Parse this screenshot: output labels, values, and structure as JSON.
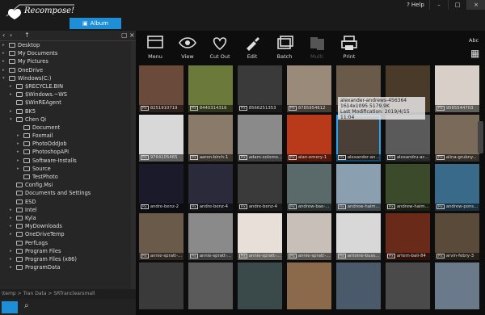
{
  "app": {
    "name": "Recompose!",
    "tab": "Album"
  },
  "window": {
    "help": "Help",
    "minimize": "–",
    "maximize": "□",
    "close": "×"
  },
  "sidebar": {
    "items": [
      {
        "label": "Desktop",
        "level": 0,
        "exp": "closed"
      },
      {
        "label": "My Documents",
        "level": 0,
        "exp": "closed"
      },
      {
        "label": "My Pictures",
        "level": 0,
        "exp": "closed"
      },
      {
        "label": "OneDrive",
        "level": 0,
        "exp": "closed"
      },
      {
        "label": "Windows(C:)",
        "level": 0,
        "exp": "open"
      },
      {
        "label": "$RECYCLE.BIN",
        "level": 1,
        "exp": "closed"
      },
      {
        "label": "$Windows.~WS",
        "level": 1,
        "exp": "closed"
      },
      {
        "label": "$WinREAgent",
        "level": 1,
        "exp": "none"
      },
      {
        "label": "BK5",
        "level": 1,
        "exp": "closed"
      },
      {
        "label": "Chen Qi",
        "level": 1,
        "exp": "open"
      },
      {
        "label": "Document",
        "level": 2,
        "exp": "none"
      },
      {
        "label": "Foxmail",
        "level": 2,
        "exp": "closed"
      },
      {
        "label": "PhotoOddJob",
        "level": 2,
        "exp": "closed"
      },
      {
        "label": "PhotoshopAPI",
        "level": 2,
        "exp": "closed"
      },
      {
        "label": "Software-Installs",
        "level": 2,
        "exp": "closed"
      },
      {
        "label": "Source",
        "level": 2,
        "exp": "closed"
      },
      {
        "label": "TestPhoto",
        "level": 2,
        "exp": "none"
      },
      {
        "label": "Config.Msi",
        "level": 1,
        "exp": "none"
      },
      {
        "label": "Documents and Settings",
        "level": 1,
        "exp": "none"
      },
      {
        "label": "ESD",
        "level": 1,
        "exp": "none"
      },
      {
        "label": "Intel",
        "level": 1,
        "exp": "closed"
      },
      {
        "label": "Kyla",
        "level": 1,
        "exp": "closed"
      },
      {
        "label": "MyDownloads",
        "level": 1,
        "exp": "closed"
      },
      {
        "label": "OneDriveTemp",
        "level": 1,
        "exp": "closed"
      },
      {
        "label": "PerfLogs",
        "level": 1,
        "exp": "none"
      },
      {
        "label": "Program Files",
        "level": 1,
        "exp": "closed"
      },
      {
        "label": "Program Files (x86)",
        "level": 1,
        "exp": "closed"
      },
      {
        "label": "ProgramData",
        "level": 1,
        "exp": "closed"
      }
    ],
    "path": "\\temp > Tran Data > SRTranclearsmall"
  },
  "toolbar": {
    "items": [
      {
        "label": "Menu",
        "icon": "menu-icon",
        "enabled": true
      },
      {
        "label": "View",
        "icon": "eye-icon",
        "enabled": true
      },
      {
        "label": "Cut Out",
        "icon": "heart-cutout-icon",
        "enabled": true
      },
      {
        "label": "Edit",
        "icon": "brush-icon",
        "enabled": true
      },
      {
        "label": "Batch",
        "icon": "batch-icon",
        "enabled": true
      },
      {
        "label": "Multi",
        "icon": "multi-icon",
        "enabled": false
      },
      {
        "label": "Print",
        "icon": "printer-icon",
        "enabled": true
      }
    ],
    "sort": "Abc"
  },
  "thumbnails": [
    {
      "label": "8251910719",
      "color": "#6a4a3a"
    },
    {
      "label": "8440314316",
      "color": "#6b7a3a"
    },
    {
      "label": "8566251353",
      "color": "#3a3a3a"
    },
    {
      "label": "8785954612",
      "color": "#9a8a7a"
    },
    {
      "label": "alexander-andrews-456364",
      "color": "#6a5a4a"
    },
    {
      "label": "",
      "color": "#4a3a2a"
    },
    {
      "label": "9565544703",
      "color": "#d8d0c8"
    },
    {
      "label": "9764105465",
      "color": "#d8d8d8"
    },
    {
      "label": "aaron-birch-1",
      "color": "#8a7a6a"
    },
    {
      "label": "adam-solomo...",
      "color": "#8a8a8a"
    },
    {
      "label": "alan-emery-1",
      "color": "#b83a1a"
    },
    {
      "label": "alexander-an...",
      "color": "#4a4038"
    },
    {
      "label": "alexandru-ac...",
      "color": "#5a5a5a"
    },
    {
      "label": "alina-grubny...",
      "color": "#7a6a5a"
    },
    {
      "label": "andre-benz-2",
      "color": "#1a1a2a"
    },
    {
      "label": "andre-benz-4",
      "color": "#2a2a3a"
    },
    {
      "label": "andre-benz-4",
      "color": "#3a3a3a"
    },
    {
      "label": "andrew-bae-...",
      "color": "#5a6a6a"
    },
    {
      "label": "andrew-haim...",
      "color": "#8aa0b0"
    },
    {
      "label": "andrew-haim...",
      "color": "#3a4a2a"
    },
    {
      "label": "andrew-pons...",
      "color": "#3a6a8a"
    },
    {
      "label": "annie-spratt-...",
      "color": "#6a5a4a"
    },
    {
      "label": "annie-spratt-...",
      "color": "#8a8a8a"
    },
    {
      "label": "annie-spratt-...",
      "color": "#e8e0d8"
    },
    {
      "label": "annie-spratt-...",
      "color": "#c8c0b8"
    },
    {
      "label": "antoine-buss...",
      "color": "#d8d8d8"
    },
    {
      "label": "artem-bali-84",
      "color": "#6a2a1a"
    },
    {
      "label": "arvin-febry-3",
      "color": "#5a4a3a"
    },
    {
      "label": "",
      "color": "#3a3a3a"
    },
    {
      "label": "",
      "color": "#5a5a5a"
    },
    {
      "label": "",
      "color": "#3a4a4a"
    },
    {
      "label": "",
      "color": "#8a6a4a"
    },
    {
      "label": "",
      "color": "#4a5a6a"
    },
    {
      "label": "",
      "color": "#4a4a4a"
    },
    {
      "label": "",
      "color": "#6a7a8a"
    }
  ],
  "tooltip": {
    "name": "alexander-andrews-456364",
    "dims": "1614x1095 5179.9K",
    "modified": "Last Modification: 2019/4/15 11:04"
  }
}
